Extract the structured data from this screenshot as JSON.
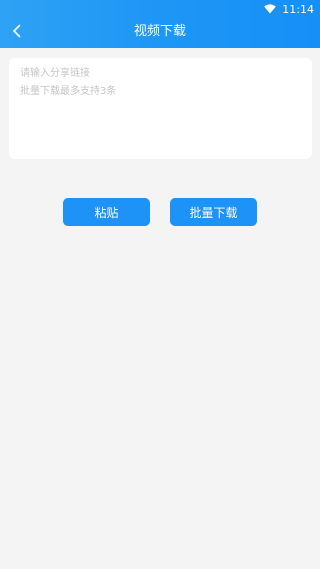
{
  "status_bar": {
    "time": "11:14",
    "wifi_icon": "wifi-icon"
  },
  "header": {
    "back_icon": "chevron-left-icon",
    "title": "视频下载",
    "gradient_from": "#2ea2f4",
    "gradient_to": "#1690f7"
  },
  "input": {
    "value": "",
    "placeholder": "请输入分享链接\n批量下载最多支持3条"
  },
  "actions": {
    "paste_label": "粘贴",
    "batch_download_label": "批量下载",
    "button_color": "#1d93f8"
  }
}
